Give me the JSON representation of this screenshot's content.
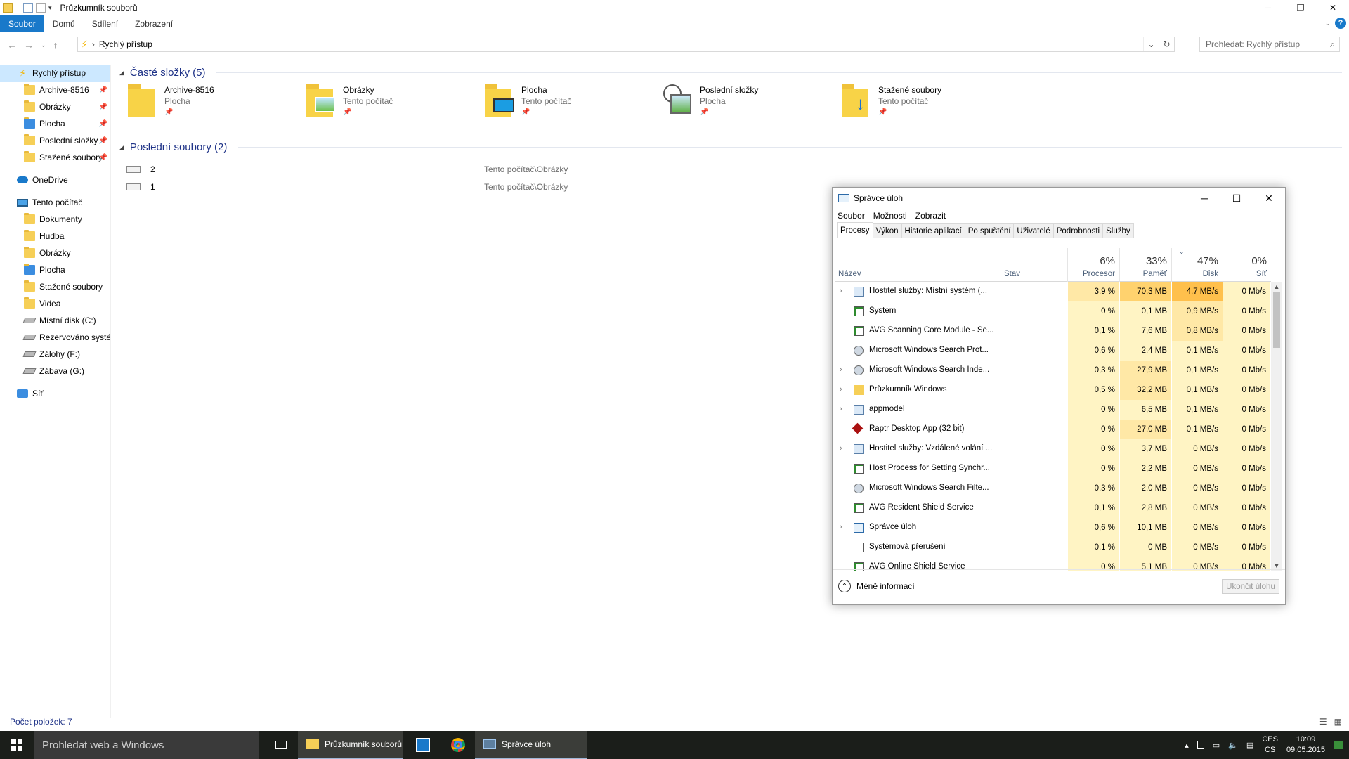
{
  "explorer": {
    "title": "Průzkumník souborů",
    "ribbon_tabs": [
      {
        "label": "Soubor",
        "active": true
      },
      {
        "label": "Domů",
        "active": false
      },
      {
        "label": "Sdílení",
        "active": false
      },
      {
        "label": "Zobrazení",
        "active": false
      }
    ],
    "help_label": "?",
    "address": {
      "path": "Rychlý přístup"
    },
    "search": {
      "placeholder": "Prohledat: Rychlý přístup"
    },
    "sidebar": {
      "quick_access": {
        "label": "Rychlý přístup",
        "items": [
          "Archive-8516",
          "Obrázky",
          "Plocha",
          "Poslední složky",
          "Stažené soubory"
        ]
      },
      "onedrive": {
        "label": "OneDrive"
      },
      "this_pc": {
        "label": "Tento počítač",
        "items": [
          "Dokumenty",
          "Hudba",
          "Obrázky",
          "Plocha",
          "Stažené soubory",
          "Videa",
          "Místní disk (C:)",
          "Rezervováno systém",
          "Zálohy (F:)",
          "Zábava (G:)"
        ]
      },
      "network": {
        "label": "Síť"
      }
    },
    "frequent": {
      "header": "Časté složky (5)",
      "items": [
        {
          "name": "Archive-8516",
          "location": "Plocha",
          "icon": "folder"
        },
        {
          "name": "Obrázky",
          "location": "Tento počítač",
          "icon": "pictures-folder"
        },
        {
          "name": "Plocha",
          "location": "Tento počítač",
          "icon": "desktop-folder"
        },
        {
          "name": "Poslední složky",
          "location": "Plocha",
          "icon": "recent-folder"
        },
        {
          "name": "Stažené soubory",
          "location": "Tento počítač",
          "icon": "downloads-folder"
        }
      ]
    },
    "recent": {
      "header": "Poslední soubory (2)",
      "items": [
        {
          "name": "2",
          "location": "Tento počítač\\Obrázky"
        },
        {
          "name": "1",
          "location": "Tento počítač\\Obrázky"
        }
      ]
    },
    "status": "Počet položek: 7"
  },
  "taskmgr": {
    "title": "Správce úloh",
    "menu": [
      "Soubor",
      "Možnosti",
      "Zobrazit"
    ],
    "tabs": [
      {
        "label": "Procesy",
        "active": true
      },
      {
        "label": "Výkon",
        "active": false
      },
      {
        "label": "Historie aplikací",
        "active": false
      },
      {
        "label": "Po spuštění",
        "active": false
      },
      {
        "label": "Uživatelé",
        "active": false
      },
      {
        "label": "Podrobnosti",
        "active": false
      },
      {
        "label": "Služby",
        "active": false
      }
    ],
    "columns": {
      "name": "Název",
      "status": "Stav",
      "cpu": {
        "pct": "6%",
        "label": "Procesor"
      },
      "memory": {
        "pct": "33%",
        "label": "Paměť"
      },
      "disk": {
        "pct": "47%",
        "label": "Disk"
      },
      "network": {
        "pct": "0%",
        "label": "Síť"
      }
    },
    "processes": [
      {
        "expandable": true,
        "icon": "service-host",
        "name": "Hostitel služby: Místní systém (...",
        "cpu": "3,9 %",
        "mem": "70,3 MB",
        "disk": "4,7 MB/s",
        "net": "0 Mb/s"
      },
      {
        "expandable": false,
        "icon": "app-window",
        "name": "System",
        "cpu": "0 %",
        "mem": "0,1 MB",
        "disk": "0,9 MB/s",
        "net": "0 Mb/s"
      },
      {
        "expandable": false,
        "icon": "app-window",
        "name": "AVG Scanning Core Module - Se...",
        "cpu": "0,1 %",
        "mem": "7,6 MB",
        "disk": "0,8 MB/s",
        "net": "0 Mb/s"
      },
      {
        "expandable": false,
        "icon": "search-user",
        "name": "Microsoft Windows Search Prot...",
        "cpu": "0,6 %",
        "mem": "2,4 MB",
        "disk": "0,1 MB/s",
        "net": "0 Mb/s"
      },
      {
        "expandable": true,
        "icon": "search-user",
        "name": "Microsoft Windows Search Inde...",
        "cpu": "0,3 %",
        "mem": "27,9 MB",
        "disk": "0,1 MB/s",
        "net": "0 Mb/s"
      },
      {
        "expandable": true,
        "icon": "explorer-folder",
        "name": "Průzkumník Windows",
        "cpu": "0,5 %",
        "mem": "32,2 MB",
        "disk": "0,1 MB/s",
        "net": "0 Mb/s"
      },
      {
        "expandable": true,
        "icon": "service-host",
        "name": "appmodel",
        "cpu": "0 %",
        "mem": "6,5 MB",
        "disk": "0,1 MB/s",
        "net": "0 Mb/s"
      },
      {
        "expandable": false,
        "icon": "raptr",
        "name": "Raptr Desktop App (32 bit)",
        "cpu": "0 %",
        "mem": "27,0 MB",
        "disk": "0,1 MB/s",
        "net": "0 Mb/s"
      },
      {
        "expandable": true,
        "icon": "service-host",
        "name": "Hostitel služby: Vzdálené volání ...",
        "cpu": "0 %",
        "mem": "3,7 MB",
        "disk": "0 MB/s",
        "net": "0 Mb/s"
      },
      {
        "expandable": false,
        "icon": "app-window",
        "name": "Host Process for Setting Synchr...",
        "cpu": "0 %",
        "mem": "2,2 MB",
        "disk": "0 MB/s",
        "net": "0 Mb/s"
      },
      {
        "expandable": false,
        "icon": "search-user",
        "name": "Microsoft Windows Search Filte...",
        "cpu": "0,3 %",
        "mem": "2,0 MB",
        "disk": "0 MB/s",
        "net": "0 Mb/s"
      },
      {
        "expandable": false,
        "icon": "app-window",
        "name": "AVG Resident Shield Service",
        "cpu": "0,1 %",
        "mem": "2,8 MB",
        "disk": "0 MB/s",
        "net": "0 Mb/s"
      },
      {
        "expandable": true,
        "icon": "taskmgr",
        "name": "Správce úloh",
        "cpu": "0,6 %",
        "mem": "10,1 MB",
        "disk": "0 MB/s",
        "net": "0 Mb/s"
      },
      {
        "expandable": false,
        "icon": "app-window-plain",
        "name": "Systémová přerušení",
        "cpu": "0,1 %",
        "mem": "0 MB",
        "disk": "0 MB/s",
        "net": "0 Mb/s"
      },
      {
        "expandable": false,
        "icon": "app-window",
        "name": "AVG Online Shield Service",
        "cpu": "0 %",
        "mem": "5,1 MB",
        "disk": "0 MB/s",
        "net": "0 Mb/s"
      }
    ],
    "less_info": "Méně informací",
    "end_task": "Ukončit úlohu"
  },
  "taskbar": {
    "search_placeholder": "Prohledat web a Windows",
    "apps": [
      {
        "label": "Průzkumník souborů",
        "icon": "explorer-folder"
      },
      {
        "label": "",
        "icon": "store"
      },
      {
        "label": "",
        "icon": "chrome"
      },
      {
        "label": "Správce úloh",
        "icon": "taskmgr"
      }
    ],
    "lang": [
      "CES",
      "CS"
    ],
    "time": "10:09",
    "date": "09.05.2015"
  },
  "colors": {
    "accent": "#1979ca",
    "link": "#1e3287",
    "heat_light": "#fff4c4",
    "heat_mid": "#ffe8a6",
    "heat_high": "#ffd26e",
    "heat_peak": "#ffc04c"
  }
}
